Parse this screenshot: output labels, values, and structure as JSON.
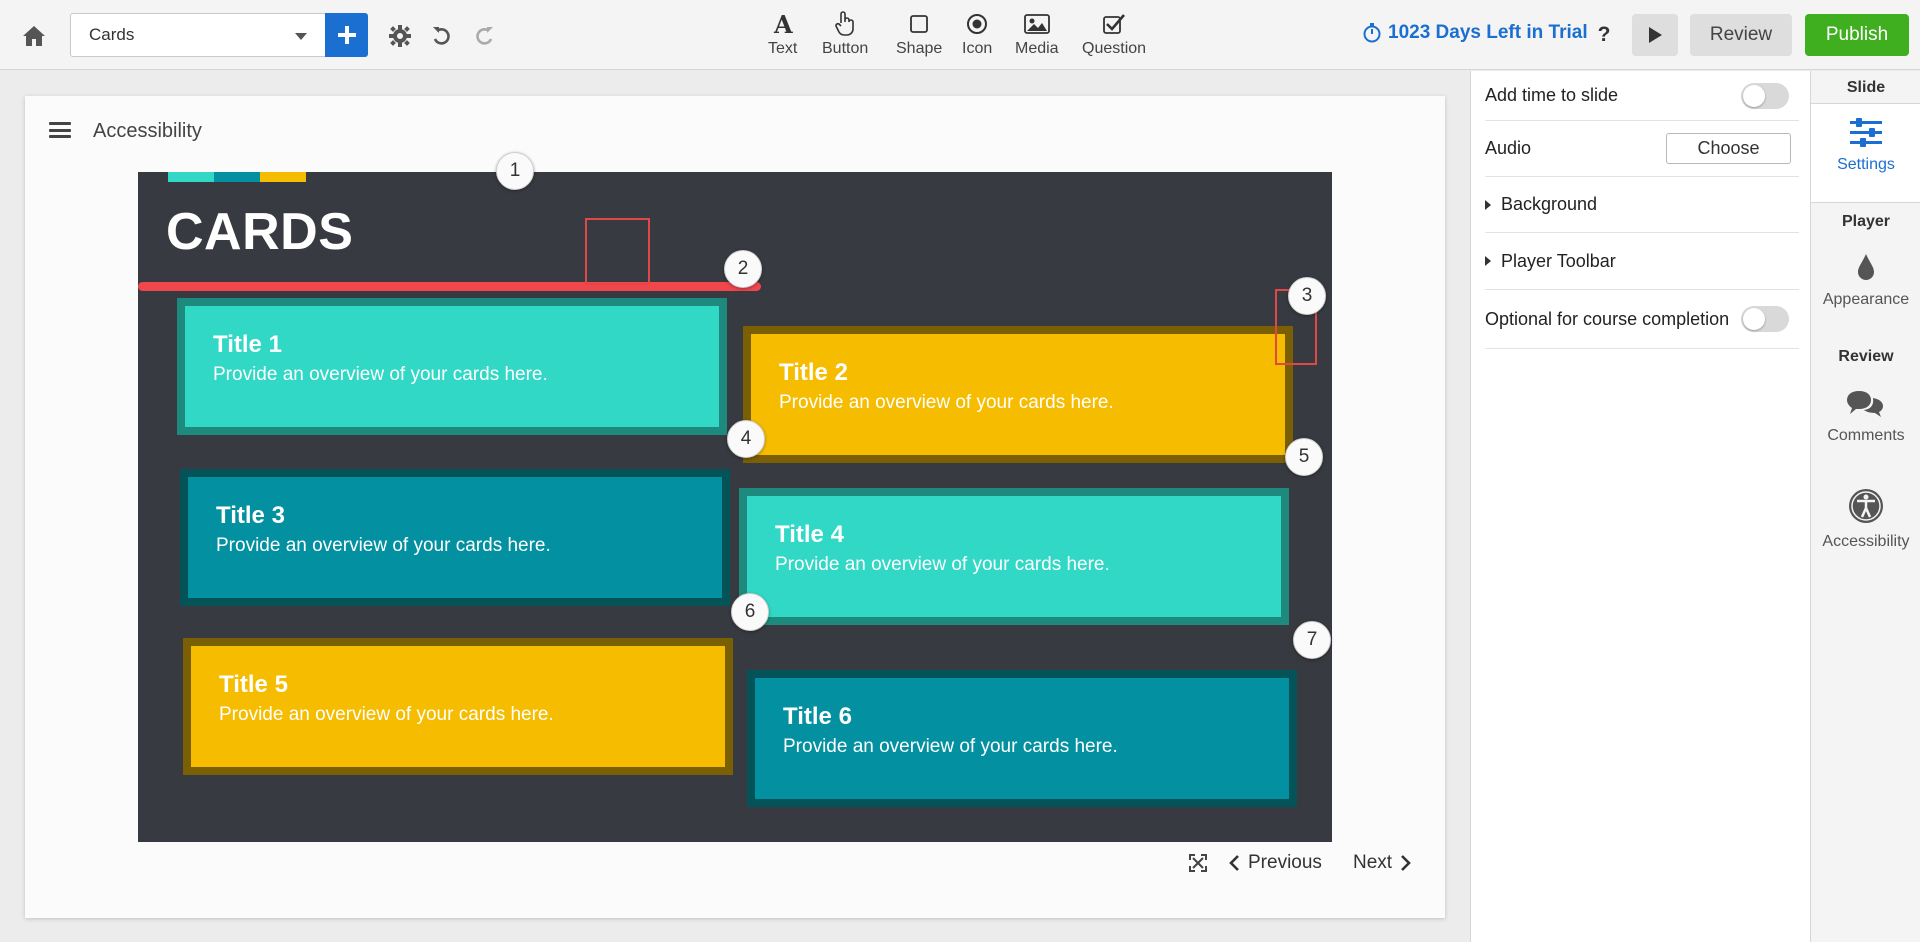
{
  "toolbar": {
    "slide_select_value": "Cards",
    "insert_items": [
      {
        "label": "Text",
        "icon": "text-icon"
      },
      {
        "label": "Button",
        "icon": "hand-pointer-icon"
      },
      {
        "label": "Shape",
        "icon": "square-icon"
      },
      {
        "label": "Icon",
        "icon": "radio-dot-icon"
      },
      {
        "label": "Media",
        "icon": "image-icon"
      },
      {
        "label": "Question",
        "icon": "checkbox-icon"
      }
    ],
    "trial_text": "1023 Days Left in Trial",
    "help_label": "?",
    "review_label": "Review",
    "publish_label": "Publish"
  },
  "player": {
    "title": "Accessibility",
    "previous_label": "Previous",
    "next_label": "Next"
  },
  "slide": {
    "heading": "CARDS",
    "cards": [
      {
        "title": "Title 1",
        "desc": "Provide an overview of your cards here.",
        "color": "teal"
      },
      {
        "title": "Title 2",
        "desc": "Provide an overview of your cards here.",
        "color": "yellow"
      },
      {
        "title": "Title 3",
        "desc": "Provide an overview of your cards here.",
        "color": "dark-teal"
      },
      {
        "title": "Title 4",
        "desc": "Provide an overview of your cards here.",
        "color": "teal"
      },
      {
        "title": "Title 5",
        "desc": "Provide an overview of your cards here.",
        "color": "yellow"
      },
      {
        "title": "Title 6",
        "desc": "Provide an overview of your cards here.",
        "color": "dark-teal"
      }
    ],
    "focus_order_badges": [
      "1",
      "2",
      "3",
      "4",
      "5",
      "6",
      "7"
    ]
  },
  "settings": {
    "add_time_label": "Add time to slide",
    "audio_label": "Audio",
    "choose_label": "Choose",
    "background_label": "Background",
    "player_toolbar_label": "Player Toolbar",
    "optional_label": "Optional for course completion"
  },
  "rail": {
    "slide_heading": "Slide",
    "settings_label": "Settings",
    "player_heading": "Player",
    "appearance_label": "Appearance",
    "review_heading": "Review",
    "comments_label": "Comments",
    "accessibility_label": "Accessibility"
  },
  "colors": {
    "accent_blue": "#1b6fd1",
    "publish_green": "#3fae1f",
    "slide_bg": "#373a40",
    "card_teal": "#31d8c6",
    "card_yellow": "#f6bc00",
    "card_dark_teal": "#0390a0",
    "annotation_red": "#f0464c"
  }
}
